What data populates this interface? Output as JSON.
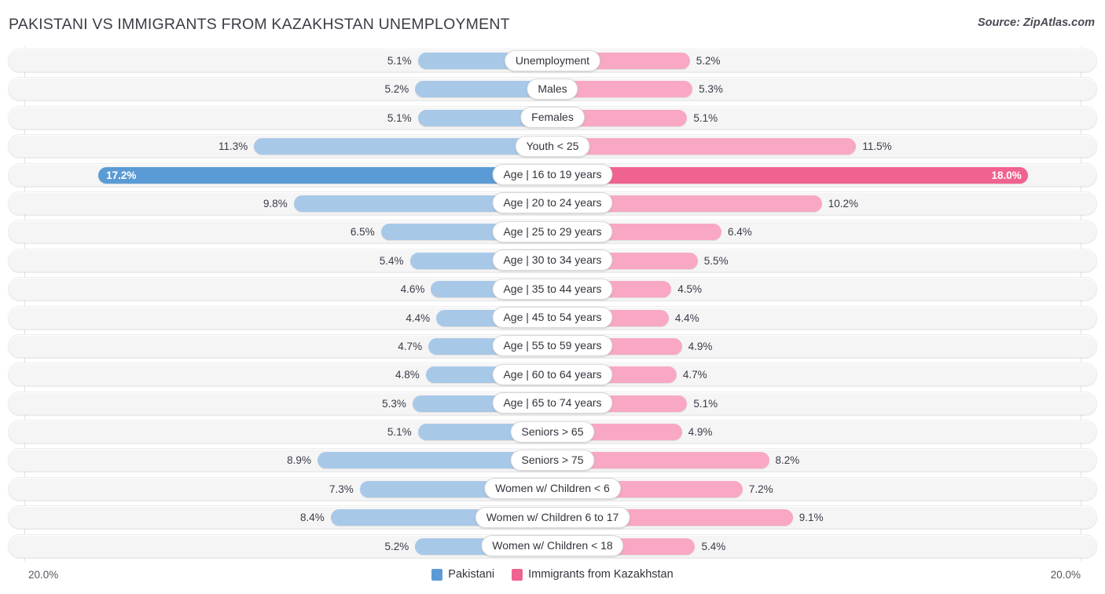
{
  "header": {
    "title": "PAKISTANI VS IMMIGRANTS FROM KAZAKHSTAN UNEMPLOYMENT",
    "source": "Source: ZipAtlas.com"
  },
  "axis": {
    "left_label": "20.0%",
    "right_label": "20.0%",
    "max": 20.0
  },
  "legend": {
    "items": [
      {
        "label": "Pakistani",
        "color": "#5b9bd5"
      },
      {
        "label": "Immigrants from Kazakhstan",
        "color": "#f0628f"
      }
    ]
  },
  "colors": {
    "left_bar": "#a8c8e8",
    "right_bar": "#f8a8c4",
    "left_bar_max": "#5b9bd5",
    "right_bar_max": "#f0628f",
    "track": "#f5f5f5",
    "text": "#3a3a4a"
  },
  "chart_data": {
    "type": "bar",
    "title": "PAKISTANI VS IMMIGRANTS FROM KAZAKHSTAN UNEMPLOYMENT",
    "subtitle": "",
    "xlabel": "",
    "ylabel": "",
    "orientation": "horizontal-diverging",
    "xlim": [
      20.0,
      20.0
    ],
    "grid": true,
    "legend_position": "bottom-center",
    "categories": [
      "Unemployment",
      "Males",
      "Females",
      "Youth < 25",
      "Age | 16 to 19 years",
      "Age | 20 to 24 years",
      "Age | 25 to 29 years",
      "Age | 30 to 34 years",
      "Age | 35 to 44 years",
      "Age | 45 to 54 years",
      "Age | 55 to 59 years",
      "Age | 60 to 64 years",
      "Age | 65 to 74 years",
      "Seniors > 65",
      "Seniors > 75",
      "Women w/ Children < 6",
      "Women w/ Children 6 to 17",
      "Women w/ Children < 18"
    ],
    "series": [
      {
        "name": "Pakistani",
        "side": "left",
        "color": "#a8c8e8",
        "values": [
          5.1,
          5.2,
          5.1,
          11.3,
          17.2,
          9.8,
          6.5,
          5.4,
          4.6,
          4.4,
          4.7,
          4.8,
          5.3,
          5.1,
          8.9,
          7.3,
          8.4,
          5.2
        ],
        "labels": [
          "5.1%",
          "5.2%",
          "5.1%",
          "11.3%",
          "17.2%",
          "9.8%",
          "6.5%",
          "5.4%",
          "4.6%",
          "4.4%",
          "4.7%",
          "4.8%",
          "5.3%",
          "5.1%",
          "8.9%",
          "7.3%",
          "8.4%",
          "5.2%"
        ]
      },
      {
        "name": "Immigrants from Kazakhstan",
        "side": "right",
        "color": "#f8a8c4",
        "values": [
          5.2,
          5.3,
          5.1,
          11.5,
          18.0,
          10.2,
          6.4,
          5.5,
          4.5,
          4.4,
          4.9,
          4.7,
          5.1,
          4.9,
          8.2,
          7.2,
          9.1,
          5.4
        ],
        "labels": [
          "5.2%",
          "5.3%",
          "5.1%",
          "11.5%",
          "18.0%",
          "10.2%",
          "6.4%",
          "5.5%",
          "4.5%",
          "4.4%",
          "4.9%",
          "4.7%",
          "5.1%",
          "4.9%",
          "8.2%",
          "7.2%",
          "9.1%",
          "5.4%"
        ]
      }
    ],
    "highlighted_row_index": 4
  }
}
